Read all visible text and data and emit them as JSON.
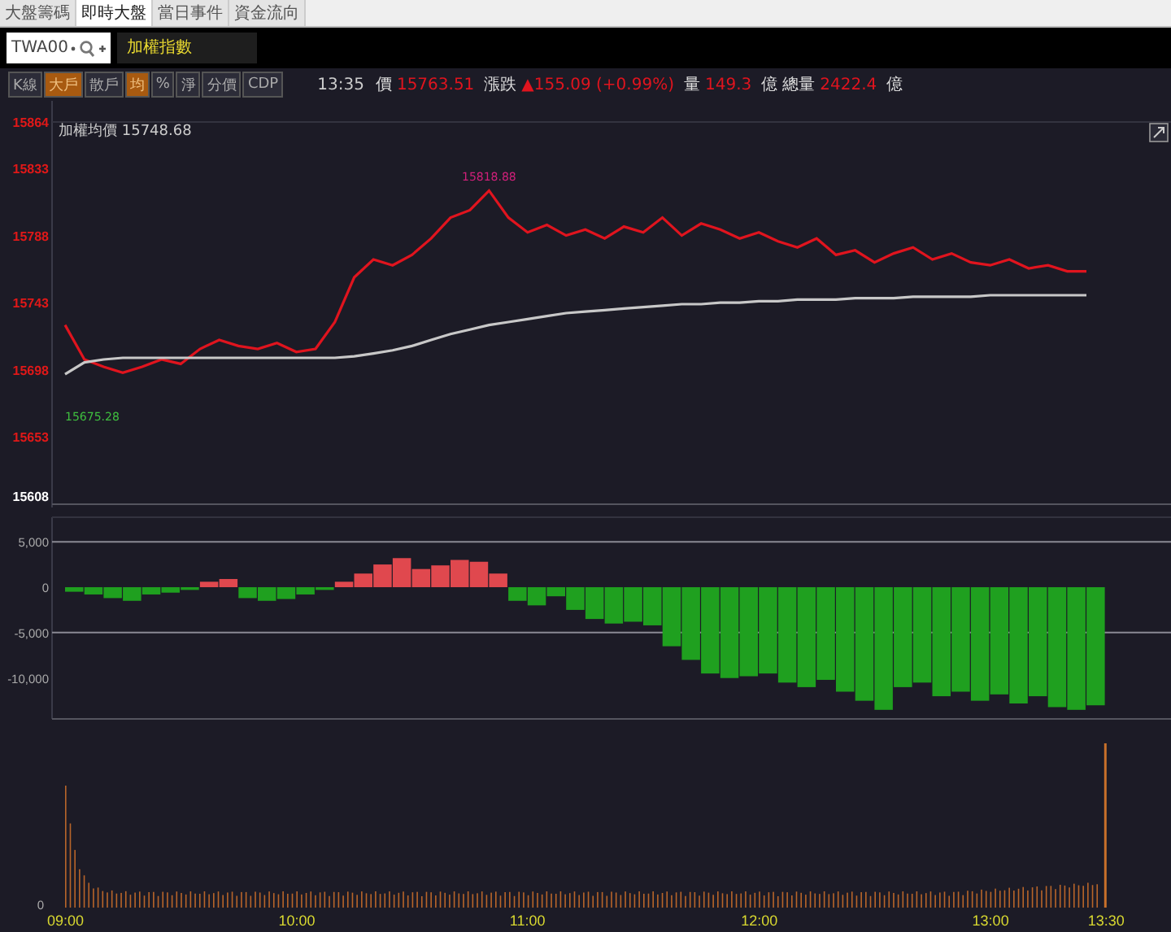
{
  "tabs": [
    {
      "label": "大盤籌碼",
      "selected": false
    },
    {
      "label": "即時大盤",
      "selected": true
    },
    {
      "label": "當日事件",
      "selected": false
    },
    {
      "label": "資金流向",
      "selected": false
    }
  ],
  "search": {
    "value": "TWA00"
  },
  "index_name": "加權指數",
  "toolbar": [
    {
      "label": "K線",
      "selected": false
    },
    {
      "label": "大戶",
      "selected": true
    },
    {
      "label": "散戶",
      "selected": false
    },
    {
      "label": "均",
      "selected": true
    },
    {
      "label": "%",
      "selected": false
    },
    {
      "label": "淨",
      "selected": false
    },
    {
      "label": "分價",
      "selected": false
    },
    {
      "label": "CDP",
      "selected": false
    }
  ],
  "quote": {
    "time": "13:35",
    "fields": [
      {
        "label": "價",
        "value": "15763.51"
      },
      {
        "label": "漲跌",
        "value": "▲155.09 (+0.99%)"
      },
      {
        "label": "量",
        "value": "149.3",
        "unit": "億"
      },
      {
        "label": "總量",
        "value": "2422.4",
        "unit": "億"
      }
    ]
  },
  "price_panel": {
    "legend_value": "15748.68",
    "chart_data": {
      "type": "line",
      "categories": [
        null,
        null,
        null,
        null,
        null,
        null,
        null,
        null,
        null,
        null,
        null,
        null,
        null,
        null,
        null,
        null,
        null,
        null,
        null,
        null,
        null,
        null,
        null,
        null,
        null,
        null,
        null,
        null,
        null,
        null,
        null,
        null,
        null,
        null,
        null,
        null,
        null,
        null,
        null,
        null,
        null,
        null,
        null,
        null,
        null,
        null,
        null,
        null,
        null,
        null,
        null,
        null,
        null,
        null,
        null
      ],
      "series": [
        {
          "color": "#e0141e",
          "values": [
            15728,
            15705,
            15700,
            15696,
            15700,
            15705,
            15702,
            15712,
            15718,
            15714,
            15712,
            15716,
            15710,
            15712,
            15730,
            15760,
            15772,
            15768,
            15775,
            15786,
            15800,
            15805,
            15818,
            15800,
            15790,
            15795,
            15788,
            15792,
            15786,
            15794,
            15790,
            15800,
            15788,
            15796,
            15792,
            15786,
            15790,
            15784,
            15780,
            15786,
            15775,
            15778,
            15770,
            15776,
            15780,
            15772,
            15776,
            15770,
            15768,
            15772,
            15766,
            15768,
            15764,
            15764,
            null
          ]
        },
        {
          "name": "加權均價",
          "color": "#c8c8c8",
          "values": [
            15695,
            15703,
            15705,
            15706,
            15706,
            15706,
            15706,
            15706,
            15706,
            15706,
            15706,
            15706,
            15706,
            15706,
            15706,
            15707,
            15709,
            15711,
            15714,
            15718,
            15722,
            15725,
            15728,
            15730,
            15732,
            15734,
            15736,
            15737,
            15738,
            15739,
            15740,
            15741,
            15742,
            15742,
            15743,
            15743,
            15744,
            15744,
            15745,
            15745,
            15745,
            15746,
            15746,
            15746,
            15747,
            15747,
            15747,
            15747,
            15748,
            15748,
            15748,
            15748,
            15748,
            15748,
            null
          ]
        }
      ],
      "ylim": [
        15608,
        15864
      ],
      "yticks": [
        15864,
        15833,
        15788,
        15743,
        15698,
        15653,
        15608
      ],
      "annotations": [
        "15818.88",
        "15675.28"
      ]
    }
  },
  "diff_panel": {
    "chart_data": {
      "type": "bar",
      "categories": [
        null,
        null,
        null,
        null,
        null,
        null,
        null,
        null,
        null,
        null,
        null,
        null,
        null,
        null,
        null,
        null,
        null,
        null,
        null,
        null,
        null,
        null,
        null,
        null,
        null,
        null,
        null,
        null,
        null,
        null,
        null,
        null,
        null,
        null,
        null,
        null,
        null,
        null,
        null,
        null,
        null,
        null,
        null,
        null,
        null,
        null,
        null,
        null,
        null,
        null,
        null,
        null,
        null,
        null,
        null
      ],
      "values": [
        -500,
        -800,
        -1200,
        -1500,
        -800,
        -600,
        -300,
        600,
        900,
        -1200,
        -1500,
        -1300,
        -800,
        -300,
        600,
        1500,
        2500,
        3200,
        2000,
        2400,
        3000,
        2800,
        1500,
        -1500,
        -2000,
        -1000,
        -2500,
        -3500,
        -4000,
        -3800,
        -4200,
        -6500,
        -8000,
        -9500,
        -10000,
        -9800,
        -9500,
        -10500,
        -11000,
        -10200,
        -11500,
        -12500,
        -13500,
        -11000,
        -10500,
        -12000,
        -11500,
        -12500,
        -11800,
        -12800,
        -12000,
        -13200,
        -13500,
        -13000,
        null
      ],
      "ylim": [
        -14500,
        7700
      ],
      "yticks": [
        {
          "value": 5000,
          "label": "5,000"
        },
        {
          "value": 0,
          "label": "0"
        },
        {
          "value": -5000,
          "label": "-5,000"
        },
        {
          "value": -10000,
          "label": "-10,000"
        }
      ]
    }
  },
  "volume_panel": {
    "axis_label": "0"
  },
  "time_axis": [
    "09:00",
    "10:00",
    "11:00",
    "12:00",
    "13:00",
    "13:30"
  ]
}
